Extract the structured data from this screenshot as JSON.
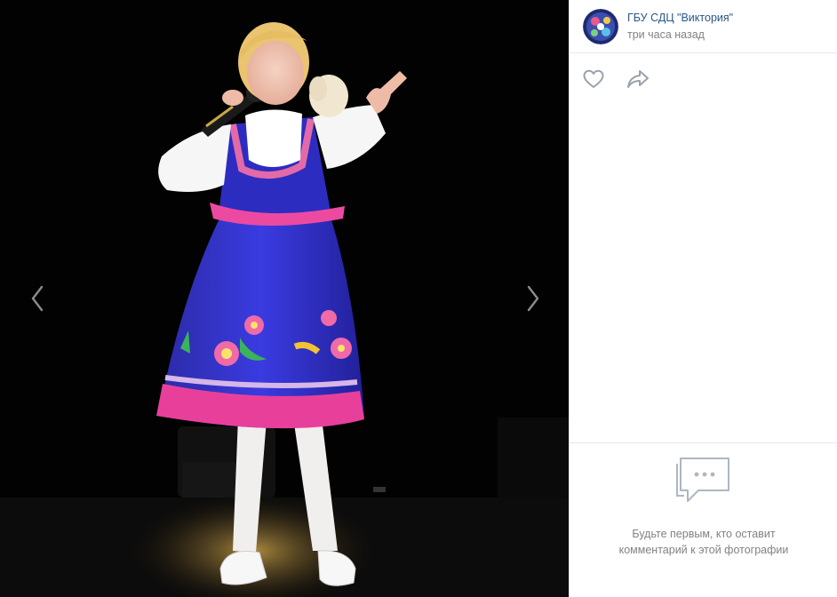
{
  "post": {
    "author": "ГБУ СДЦ \"Виктория\"",
    "time": "три часа назад"
  },
  "comments": {
    "empty_line1": "Будьте первым, кто оставит",
    "empty_line2": "комментарий к этой фотографии"
  },
  "icons": {
    "like": "heart-icon",
    "share": "share-arrow-icon",
    "prev": "chevron-left-icon",
    "next": "chevron-right-icon",
    "comments": "speech-bubble-icon"
  },
  "colors": {
    "link": "#2a5885",
    "muted": "#828282",
    "icon": "#99a2ad",
    "photo_background": "#020202"
  }
}
